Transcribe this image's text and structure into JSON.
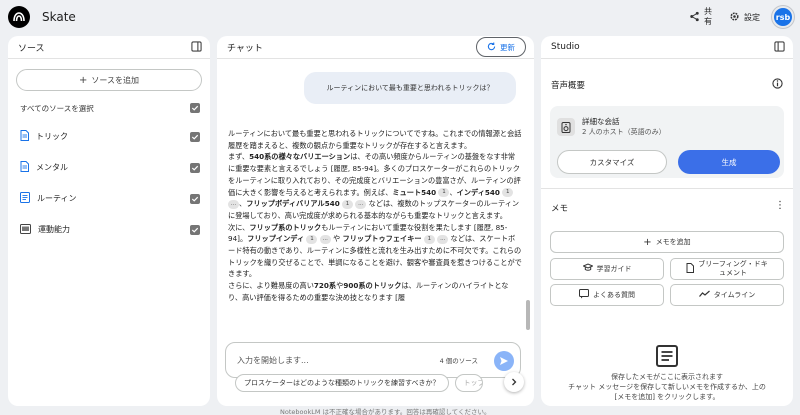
{
  "app": {
    "title": "Skate",
    "share_label": "共有",
    "settings_label": "設定",
    "avatar_text": "rsb"
  },
  "sources": {
    "title": "ソース",
    "add_label": "ソースを追加",
    "select_all_label": "すべてのソースを選択",
    "items": [
      {
        "label": "トリック",
        "icon": "document-icon"
      },
      {
        "label": "メンタル",
        "icon": "document-icon"
      },
      {
        "label": "ルーティン",
        "icon": "document-icon"
      },
      {
        "label": "運動能力",
        "icon": "slides-icon"
      }
    ]
  },
  "chat": {
    "title": "チャット",
    "refresh_label": "更新",
    "user_message": "ルーティンにおいて最も重要と思われるトリックは？",
    "answer": {
      "p1": "ルーティンにおいて最も重要と思われるトリックについてですね。これまでの情報源と会話履歴を踏まえると、複数の観点から重要なトリックが存在すると言えます。",
      "p2_a": "まず、",
      "p2_b": "540系の様々なバリエーション",
      "p2_c": "は、その高い頻度からルーティンの基盤をなす非常に重要な要素と言えるでしょう [履歴, 85-94]。多くのプロスケーターがこれらのトリックをルーティンに取り入れており、その完成度とバリエーションの豊富さが、ルーティンの評価に大きく影響を与えると考えられます。例えば、",
      "p2_d": "ミュート540",
      "p2_e": "、",
      "p2_f": "インディ540",
      "p2_g": "、",
      "p2_h": "フリップボディバリアル540",
      "p2_i": "などは、複数のトップスケーターのルーティンに登場しており、高い完成度が求められる基本的ながらも重要なトリックと言えます。",
      "p3_a": "次に、",
      "p3_b": "フリップ系のトリック",
      "p3_c": "もルーティンにおいて重要な役割を果たします [履歴, 85-94]。",
      "p3_d": "フリップインディ",
      "p3_e": "や",
      "p3_f": "フリップトゥフェイキー",
      "p3_g": "などは、スケートボード特有の動きであり、ルーティンに多様性と流れを生み出すために不可欠です。これらのトリックを織り交ぜることで、単調になることを避け、観客や審査員を惹きつけることができます。",
      "p4_a": "さらに、より難易度の高い",
      "p4_b": "720系",
      "p4_c": "や",
      "p4_d": "900系のトリック",
      "p4_e": "は、ルーティンのハイライトとなり、高い評価を得るための重要な決め技となります [履",
      "cite": "1",
      "more": "..."
    },
    "input_placeholder": "入力を開始します...",
    "source_count": "4 個のソース",
    "suggestions": [
      "プロスケーターはどのような種類のトリックを練習すべきか？",
      "トップ"
    ]
  },
  "studio": {
    "title": "Studio",
    "audio_overview": {
      "title": "音声概要",
      "card_title": "詳細な会話",
      "card_subtitle": "2 人のホスト（英語のみ）",
      "customize_label": "カスタマイズ",
      "generate_label": "生成"
    },
    "notes": {
      "title": "メモ",
      "add_label": "メモを追加",
      "study_guide": "学習ガイド",
      "briefing_doc_1": "ブリーフィング・ドキ",
      "briefing_doc_2": "ュメント",
      "faq": "よくある質問",
      "timeline": "タイムライン"
    },
    "empty": {
      "line1": "保存したメモがここに表示されます",
      "line2": "チャット メッセージを保存して新しいメモを作成するか、上の",
      "line3": "[メモを追加] をクリックします。"
    }
  },
  "footer": "NotebookLM は不正確な場合があります。回答は再確認してください。"
}
